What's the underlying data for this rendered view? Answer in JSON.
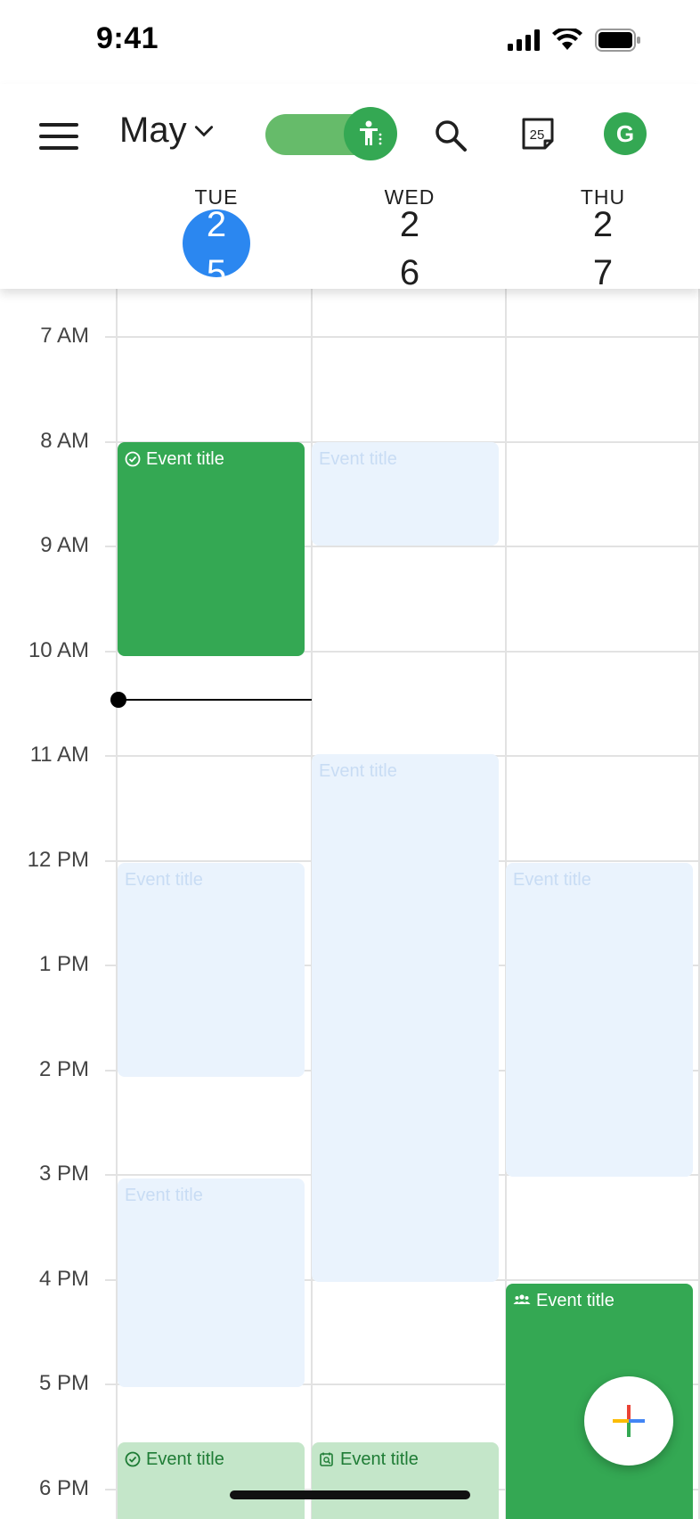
{
  "status_bar": {
    "time": "9:41"
  },
  "header": {
    "month": "May",
    "avatar_initial": "G",
    "today_icon_number": "25"
  },
  "days": [
    {
      "name": "TUE",
      "num_top": "2",
      "num_bottom": "5",
      "today": true
    },
    {
      "name": "WED",
      "num_top": "2",
      "num_bottom": "6",
      "today": false
    },
    {
      "name": "THU",
      "num_top": "2",
      "num_bottom": "7",
      "today": false
    }
  ],
  "hours": [
    "7 AM",
    "8 AM",
    "9 AM",
    "10 AM",
    "11 AM",
    "12 PM",
    "1 PM",
    "2 PM",
    "3 PM",
    "4 PM",
    "5 PM",
    "6 PM"
  ],
  "events": [
    {
      "title": "Event title",
      "day": "TUE",
      "start": "8 AM",
      "end": "10 AM",
      "style": "solid",
      "icon": "task-check-icon"
    },
    {
      "title": "Event title",
      "day": "WED",
      "start": "8 AM",
      "end": "9 AM",
      "style": "ghost",
      "icon": ""
    },
    {
      "title": "Event title",
      "day": "WED",
      "start": "11 AM",
      "end": "4 PM",
      "style": "ghost",
      "icon": ""
    },
    {
      "title": "Event title",
      "day": "TUE",
      "start": "12 PM",
      "end": "2 PM",
      "style": "ghost",
      "icon": ""
    },
    {
      "title": "Event title",
      "day": "THU",
      "start": "12 PM",
      "end": "3 PM",
      "style": "ghost",
      "icon": ""
    },
    {
      "title": "Event title",
      "day": "TUE",
      "start": "3 PM",
      "end": "5 PM",
      "style": "ghost",
      "icon": ""
    },
    {
      "title": "Event title",
      "day": "THU",
      "start": "4 PM",
      "end": "",
      "style": "solid",
      "icon": "group-icon"
    },
    {
      "title": "Event title",
      "day": "TUE",
      "start": "5:30 PM",
      "end": "",
      "style": "light",
      "icon": "task-check-icon"
    },
    {
      "title": "Event title",
      "day": "WED",
      "start": "5:30 PM",
      "end": "",
      "style": "light",
      "icon": "appointment-search-icon"
    }
  ],
  "current_time_indicator": {
    "day": "TUE",
    "time": "10:28 AM"
  },
  "colors": {
    "accent_green": "#34a853",
    "today_blue": "#2b87f0",
    "ghost_event": "#eaf3fd",
    "light_green_event": "#c4e6c9"
  }
}
